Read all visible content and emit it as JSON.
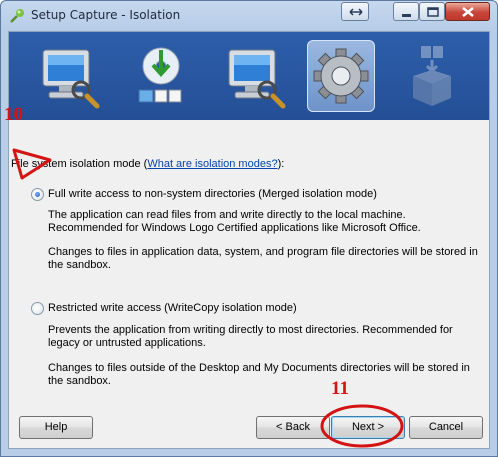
{
  "window": {
    "title": "Setup Capture - Isolation"
  },
  "section": {
    "label_prefix": "File system isolation mode (",
    "link": "What are isolation modes?",
    "label_suffix": "):"
  },
  "options": [
    {
      "label": "Full write access to non-system directories (Merged isolation mode)",
      "selected": true,
      "desc1": "The application can read files from and write directly to the local machine.",
      "desc2": "Recommended for Windows Logo Certified applications like Microsoft Office.",
      "desc3": "Changes to files in application data, system, and program file directories will be stored in",
      "desc4": "the sandbox."
    },
    {
      "label": "Restricted write access (WriteCopy isolation mode)",
      "selected": false,
      "desc1": "Prevents the application from writing directly to most directories. Recommended for",
      "desc2": "legacy or untrusted applications.",
      "desc3": "Changes to files outside of the Desktop and My Documents directories will be stored in",
      "desc4": "the sandbox."
    }
  ],
  "buttons": {
    "help": "Help",
    "back": "< Back",
    "next": "Next >",
    "cancel": "Cancel"
  },
  "annotations": {
    "step10": "10",
    "step11": "11"
  },
  "colors": {
    "annotation": "#d41414",
    "link": "#0645ad",
    "banner": "#2e5eaa"
  },
  "icons": [
    "computer-magnifier-icon",
    "install-cd-icon",
    "computer-magnifier-icon",
    "gear-icon",
    "package-icon"
  ]
}
